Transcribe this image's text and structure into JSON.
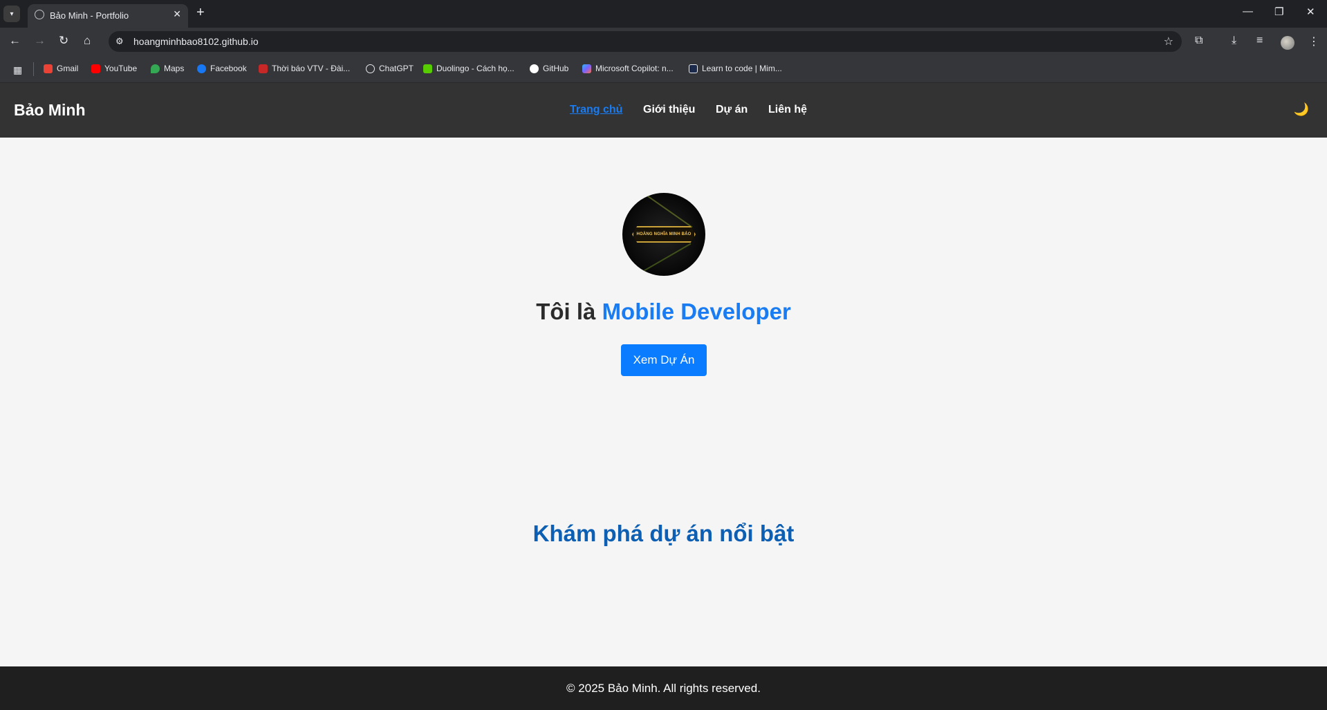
{
  "browser": {
    "tab_title": "Bảo Minh - Portfolio",
    "url": "hoangminhbao8102.github.io",
    "bookmarks": [
      {
        "label": "Gmail",
        "color": "#ea4335"
      },
      {
        "label": "YouTube",
        "color": "#ff0000"
      },
      {
        "label": "Maps",
        "color": "#34a853"
      },
      {
        "label": "Facebook",
        "color": "#1877f2"
      },
      {
        "label": "Thời báo VTV - Đài...",
        "color": "#c62828"
      },
      {
        "label": "ChatGPT",
        "color": "#e8eaed"
      },
      {
        "label": "Duolingo - Cách họ...",
        "color": "#58cc02"
      },
      {
        "label": "GitHub",
        "color": "#ffffff"
      },
      {
        "label": "Microsoft Copilot: n...",
        "color": "#7b61ff"
      },
      {
        "label": "Learn to code | Mim...",
        "color": "#1b2a4a"
      }
    ]
  },
  "site": {
    "logo": "Bảo Minh",
    "nav": [
      "Trang chủ",
      "Giới thiệu",
      "Dự án",
      "Liên hệ"
    ],
    "active_nav": "Trang chủ",
    "theme_icon": "moon-icon",
    "avatar_badge_text": "HOÀNG NGHĨA MINH BẢO"
  },
  "hero": {
    "prefix": "Tôi là",
    "role": "Mobile Developer",
    "cta": "Xem Dự Án"
  },
  "projects": {
    "title": "Khám phá dự án nổi bật"
  },
  "footer": {
    "text": "© 2025 Bảo Minh. All rights reserved."
  },
  "colors": {
    "accent": "#1a7cf2",
    "header_bg": "#333333",
    "footer_bg": "#1f1f1f",
    "page_bg": "#f5f5f5"
  }
}
